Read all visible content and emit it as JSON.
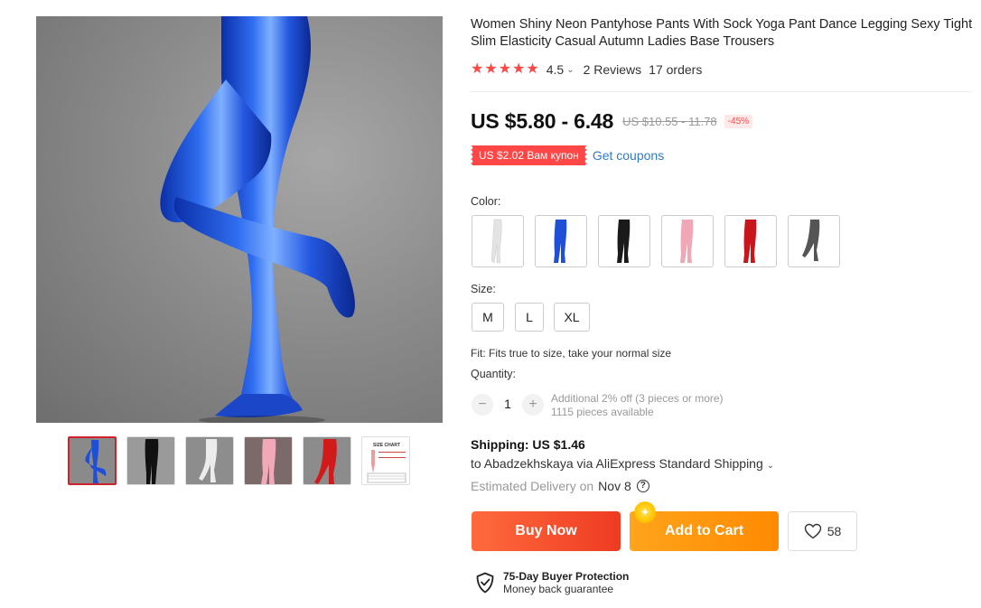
{
  "product": {
    "title": "Women Shiny Neon Pantyhose Pants With Sock Yoga Pant Dance Legging Sexy Tight Slim Elasticity Casual Autumn Ladies Base Trousers",
    "rating": "4.5",
    "rating_chevron": "⌄",
    "reviews": "2 Reviews",
    "orders": "17 orders",
    "price": "US $5.80 - 6.48",
    "old_price": "US $10.55 - 11.78",
    "discount": "-45%",
    "coupon": "US $2.02 Вам купон",
    "get_coupons": "Get coupons"
  },
  "gallery": {
    "thumbnails": [
      {
        "color": "#1e4fd6",
        "legs": "#1e4fd6"
      },
      {
        "color": "#111111",
        "legs": "#111111"
      },
      {
        "color": "#e8e8e8",
        "legs": "#e8e8e8"
      },
      {
        "color": "#f1a9b8",
        "legs": "#f1a9b8"
      },
      {
        "color": "#d11a1a",
        "legs": "#d11a1a"
      },
      {
        "color": "size-chart",
        "title": "SIZE CHART"
      }
    ]
  },
  "options": {
    "color_label": "Color:",
    "colors": [
      "#e6e6e6",
      "#1e4fd6",
      "#1a1a1a",
      "#f0a8b6",
      "#c8161c",
      "#555555"
    ],
    "size_label": "Size:",
    "sizes": [
      "M",
      "L",
      "XL"
    ],
    "fit": "Fit: Fits true to size, take your normal size",
    "quantity_label": "Quantity:",
    "quantity": "1",
    "minus": "−",
    "plus": "+",
    "qty_note_1": "Additional 2% off (3 pieces or more)",
    "qty_note_2": "1115 pieces available"
  },
  "shipping": {
    "cost": "Shipping: US $1.46",
    "to": "to Abadzekhskaya via AliExpress Standard Shipping",
    "chevron": "⌄",
    "estimated_label": "Estimated Delivery on",
    "date": "Nov 8",
    "help": "?"
  },
  "actions": {
    "buy_now": "Buy Now",
    "add_to_cart": "Add to Cart",
    "cart_badge": "✦",
    "wishlist_count": "58"
  },
  "protection": {
    "title": "75-Day Buyer Protection",
    "subtitle": "Money back guarantee"
  },
  "colors": {
    "accent_red": "#ff4747",
    "link_blue": "#2e7bc8",
    "buy_now": "#ee3b22",
    "add_to_cart": "#ff8a00"
  }
}
